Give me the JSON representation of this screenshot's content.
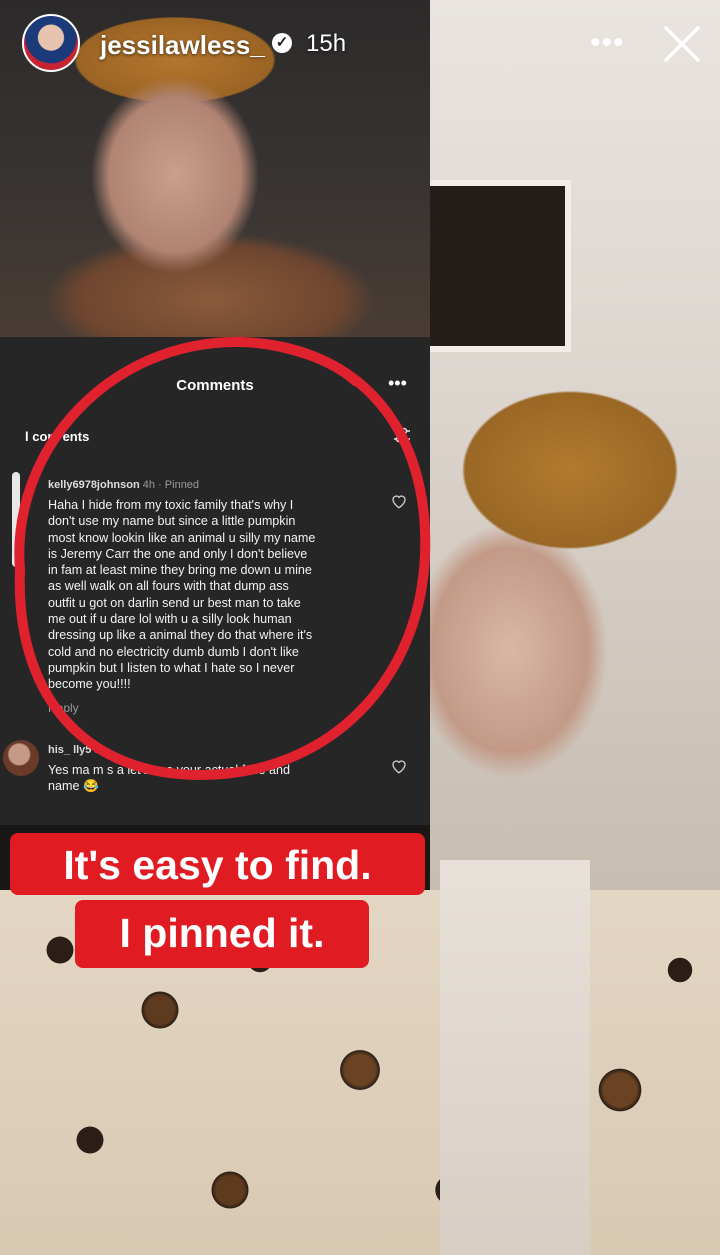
{
  "header": {
    "username": "jessilawless_",
    "verified_glyph": "✓",
    "time_ago": "15h",
    "more_glyph": "•••",
    "icons": [
      "avatar",
      "verified-badge-icon",
      "more-icon",
      "close-icon"
    ]
  },
  "comments_panel": {
    "title": "Comments",
    "more_glyph": "•••",
    "count_label": "l com  ents",
    "comments": [
      {
        "user": "kelly6978johnson",
        "meta": "4h · Pinned",
        "lines": [
          "Haha I hide from my toxic family that's why I",
          "don't use my name but since a little pumpkin",
          "most know lookin like an animal u silly my name",
          "is Jeremy Carr the one and only I don't believe",
          "in fam at least mine they bring me down u mine",
          "as well walk on all fours with that dump ass",
          "outfit u got on darlin send ur best man to take",
          "me out if u dare lol with u a silly look human",
          "dressing up like a animal they do that where it's",
          "cold and no electricity dumb dumb I don't like",
          "pumpkin but I listen to what I hate so I never",
          "become you!!!!"
        ],
        "reply": "Reply"
      },
      {
        "user": "his_   lly5",
        "meta": "1h",
        "lines": [
          "Yes ma  m  s a let's see your actual face and",
          "name 😂"
        ],
        "reply": ""
      }
    ]
  },
  "captions": {
    "line1": "It's easy to find.",
    "line2": "I pinned it."
  },
  "colors": {
    "caption_red": "#e01b22",
    "panel_bg": "#262626",
    "circle_red": "#e0222f"
  }
}
